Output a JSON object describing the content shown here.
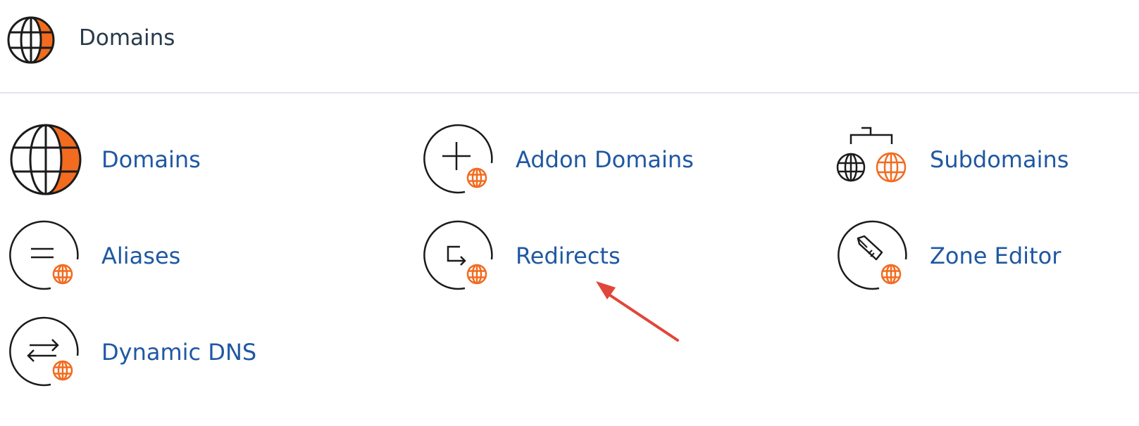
{
  "section": {
    "title": "Domains",
    "icon": "globe-icon"
  },
  "items": [
    {
      "label": "Domains",
      "icon": "globe-icon"
    },
    {
      "label": "Addon Domains",
      "icon": "plus-icon"
    },
    {
      "label": "Subdomains",
      "icon": "subdomains-icon"
    },
    {
      "label": "Aliases",
      "icon": "equals-icon"
    },
    {
      "label": "Redirects",
      "icon": "redirect-arrow-icon"
    },
    {
      "label": "Zone Editor",
      "icon": "pen-icon"
    },
    {
      "label": "Dynamic DNS",
      "icon": "exchange-arrows-icon"
    }
  ],
  "colors": {
    "accent": "#f26b1f",
    "link": "#1f58a2",
    "text": "#293a4a",
    "annotation": "#e0463a"
  }
}
